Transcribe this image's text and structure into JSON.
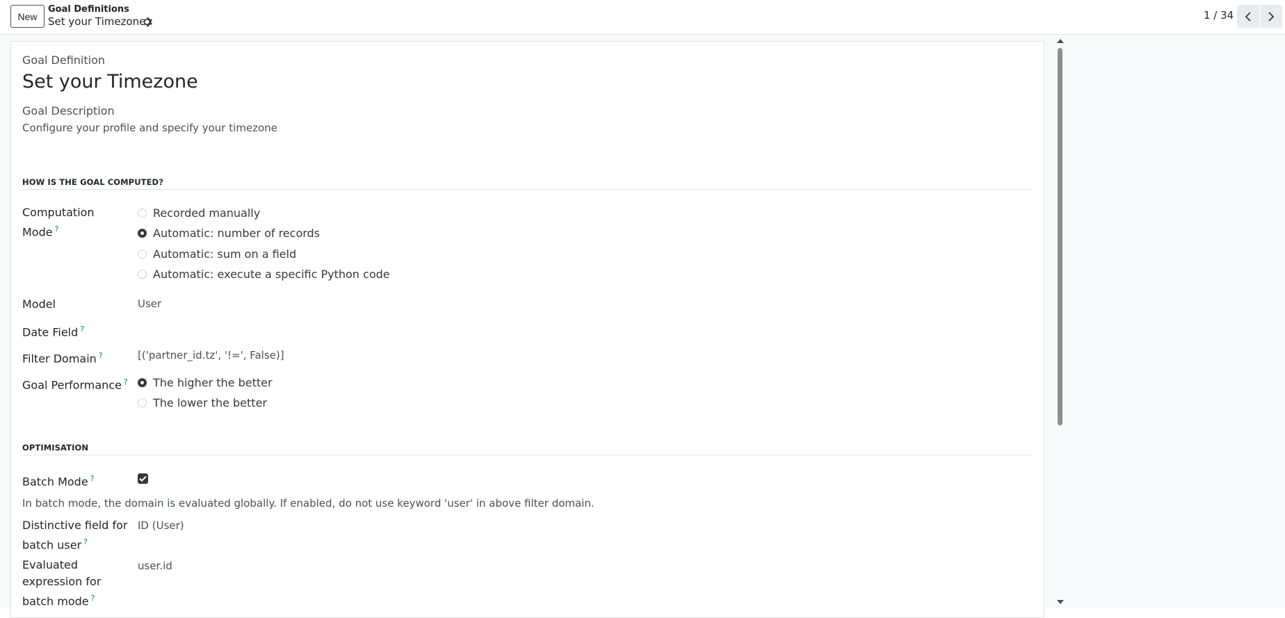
{
  "control_panel": {
    "new_label": "New",
    "breadcrumb_parent": "Goal Definitions",
    "breadcrumb_current": "Set your Timezone",
    "pager": "1 / 34"
  },
  "form": {
    "name_label": "Goal Definition",
    "name_value": "Set your Timezone",
    "description_label": "Goal Description",
    "description_value": "Configure your profile and specify your timezone",
    "section_computed": "HOW IS THE GOAL COMPUTED?",
    "computation_mode": {
      "label_line1": "Computation",
      "label_line2": "Mode",
      "options": [
        {
          "label": "Recorded manually",
          "selected": false
        },
        {
          "label": "Automatic: number of records",
          "selected": true
        },
        {
          "label": "Automatic: sum on a field",
          "selected": false
        },
        {
          "label": "Automatic: execute a specific Python code",
          "selected": false
        }
      ]
    },
    "model": {
      "label": "Model",
      "value": "User"
    },
    "date_field": {
      "label": "Date Field",
      "value": ""
    },
    "filter_domain": {
      "label": "Filter Domain",
      "value": "[('partner_id.tz', '!=', False)]"
    },
    "goal_performance": {
      "label": "Goal Performance",
      "options": [
        {
          "label": "The higher the better",
          "selected": true
        },
        {
          "label": "The lower the better",
          "selected": false
        }
      ]
    },
    "section_optimisation": "OPTIMISATION",
    "batch_mode": {
      "label": "Batch Mode",
      "checked": true
    },
    "batch_note": "In batch mode, the domain is evaluated globally. If enabled, do not use keyword 'user' in above filter domain.",
    "distinctive_field": {
      "label_line1": "Distinctive field for",
      "label_line2": "batch user",
      "value": "ID (User)"
    },
    "evaluated_expression": {
      "label_line1": "Evaluated",
      "label_line2": "expression for",
      "label_line3": "batch mode",
      "value": "user.id"
    },
    "help_mark": "?"
  }
}
